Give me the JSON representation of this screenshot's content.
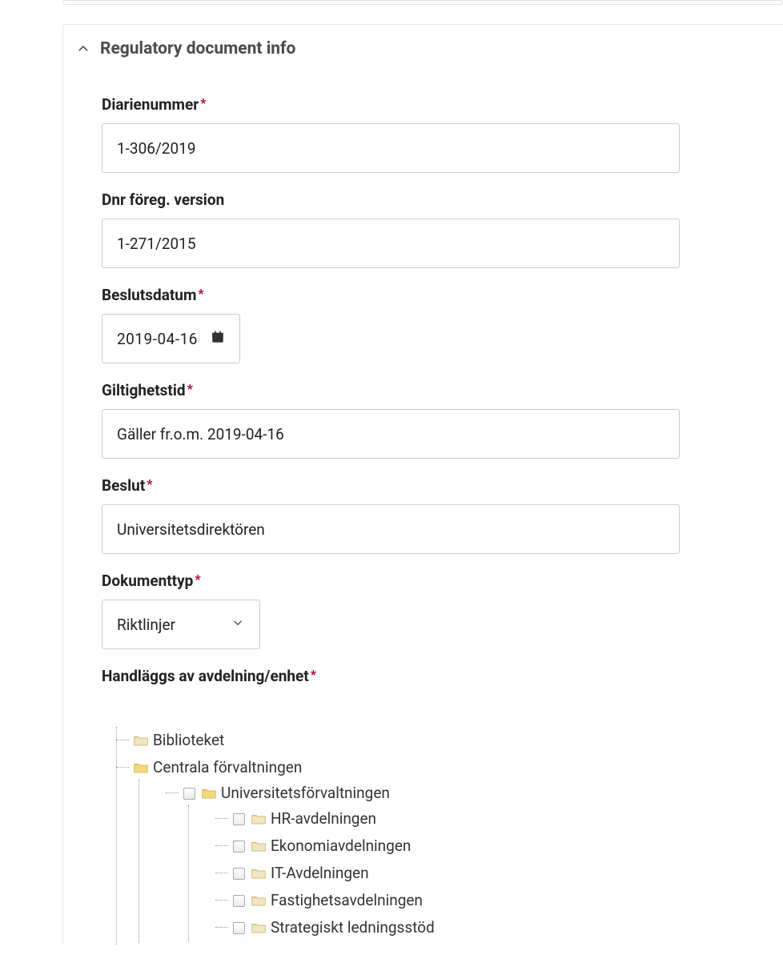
{
  "panel": {
    "title": "Regulatory document info"
  },
  "fields": {
    "diarienummer": {
      "label": "Diarienummer",
      "value": "1-306/2019",
      "required": true
    },
    "dnr_prev": {
      "label": "Dnr föreg. version",
      "value": "1-271/2015",
      "required": false
    },
    "beslutsdatum": {
      "label": "Beslutsdatum",
      "value": "2019-04-16",
      "required": true
    },
    "giltighetstid": {
      "label": "Giltighetstid",
      "value": "Gäller fr.o.m. 2019-04-16",
      "required": true
    },
    "beslut": {
      "label": "Beslut",
      "value": "Universitetsdirektören",
      "required": true
    },
    "dokumenttyp": {
      "label": "Dokumenttyp",
      "value": "Riktlinjer",
      "required": true
    },
    "handlaggs": {
      "label": "Handläggs av avdelning/enhet",
      "required": true
    }
  },
  "tree": {
    "items": [
      {
        "label": "Biblioteket"
      },
      {
        "label": "Centrala förvaltningen",
        "children": [
          {
            "label": "Universitetsförvaltningen",
            "checkbox": true,
            "children": [
              {
                "label": "HR-avdelningen",
                "checkbox": true
              },
              {
                "label": "Ekonomiavdelningen",
                "checkbox": true
              },
              {
                "label": "IT-Avdelningen",
                "checkbox": true
              },
              {
                "label": "Fastighetsavdelningen",
                "checkbox": true
              },
              {
                "label": "Strategiskt ledningsstöd",
                "checkbox": true
              }
            ]
          }
        ]
      }
    ]
  }
}
